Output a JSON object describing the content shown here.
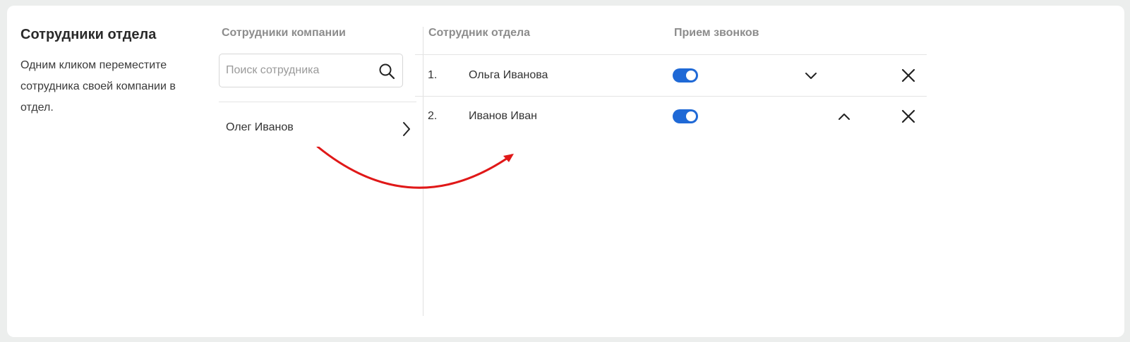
{
  "intro": {
    "title": "Сотрудники отдела",
    "description": "Одним кликом переместите сотрудника своей компании в отдел."
  },
  "company": {
    "header": "Сотрудники компании",
    "search_placeholder": "Поиск сотрудника",
    "employees": [
      {
        "name": "Олег Иванов"
      }
    ]
  },
  "department": {
    "header_employee": "Сотрудник отдела",
    "header_calls": "Прием звонков",
    "rows": [
      {
        "number": "1.",
        "name": "Ольга Иванова",
        "calls_enabled": true,
        "order_icon": "chevron-down-icon"
      },
      {
        "number": "2.",
        "name": "Иванов Иван",
        "calls_enabled": true,
        "order_icon": "chevron-up-icon"
      }
    ]
  },
  "colors": {
    "accent": "#1f69d6",
    "arrow": "#e01818",
    "header_text": "#8c8c8c"
  },
  "icons": {
    "search": "search-icon",
    "open": "chevron-right-icon",
    "remove": "close-icon",
    "annotation": "curved-arrow-icon"
  }
}
